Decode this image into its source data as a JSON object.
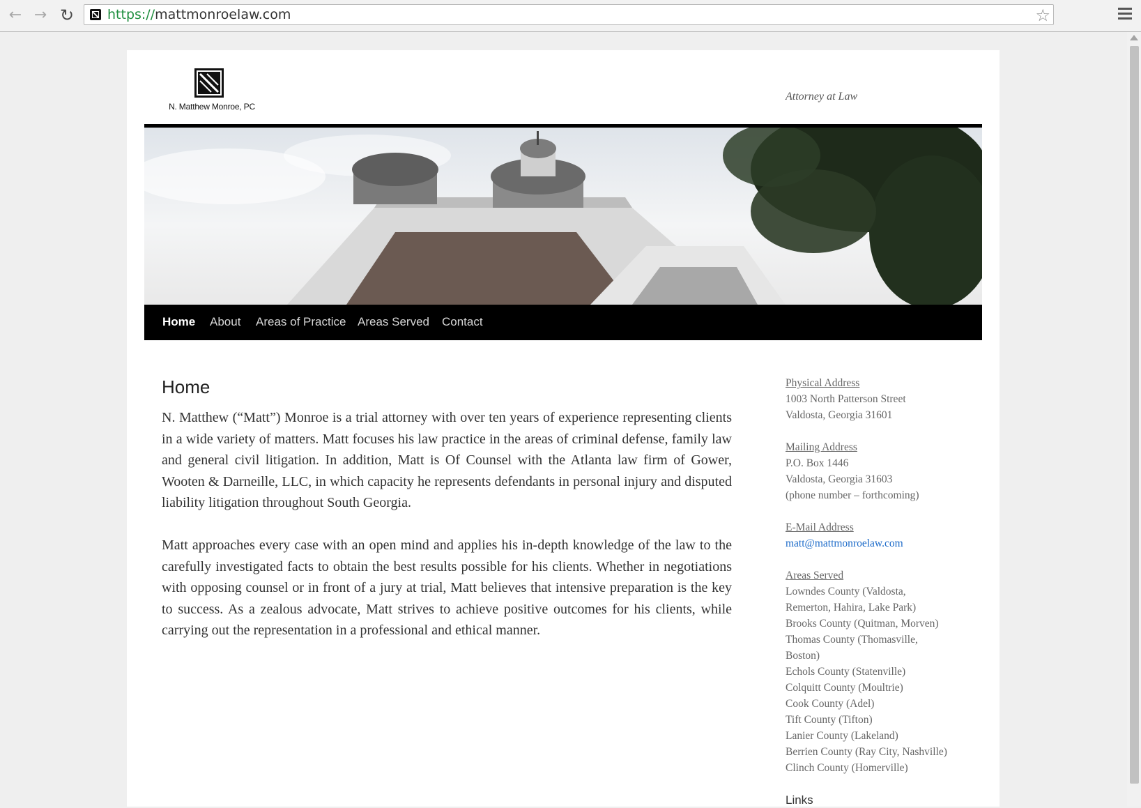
{
  "browser": {
    "url_scheme": "https://",
    "url_host": "mattmonroelaw.com",
    "back_icon": "back-arrow-icon",
    "forward_icon": "forward-arrow-icon",
    "reload_icon": "reload-icon",
    "star_icon": "bookmark-star-icon",
    "menu_icon": "hamburger-menu-icon"
  },
  "header": {
    "logo_name": "N. Matthew Monroe, PC",
    "tagline": "Attorney at Law"
  },
  "nav": {
    "items": [
      {
        "label": "Home"
      },
      {
        "label": "About"
      },
      {
        "label": "Areas of Practice"
      },
      {
        "label": "Areas Served"
      },
      {
        "label": "Contact"
      }
    ]
  },
  "main": {
    "title": "Home",
    "paragraphs": [
      "N. Matthew (“Matt”) Monroe is a trial attorney with over ten years of experience representing clients in a wide variety of matters. Matt focuses his law practice in the areas of criminal defense, family law and general civil litigation. In addition, Matt is Of Counsel with the Atlanta law firm of Gower, Wooten & Darneille, LLC, in which capacity he represents defendants in personal injury and disputed liability litigation throughout South Georgia.",
      "Matt approaches every case with an open mind and applies his in-depth knowledge of the law to the carefully investigated facts to obtain the best results possible for his clients. Whether in negotiations with opposing counsel or in front of a jury at trial, Matt believes that intensive preparation is the key to success. As a zealous advocate, Matt strives to achieve positive outcomes for his clients, while carrying out the representation in a professional and ethical manner."
    ]
  },
  "sidebar": {
    "physical": {
      "heading": "Physical Address",
      "line1": "1003 North Patterson Street",
      "line2": "Valdosta, Georgia 31601"
    },
    "mailing": {
      "heading": "Mailing Address",
      "line1": "P.O. Box 1446",
      "line2": "Valdosta, Georgia 31603",
      "line3": "(phone number – forthcoming)"
    },
    "email": {
      "heading": "E-Mail Address",
      "address": "matt@mattmonroelaw.com"
    },
    "areas": {
      "heading": "Areas Served",
      "lines": [
        "Lowndes County (Valdosta,",
        "Remerton, Hahira, Lake Park)",
        "Brooks County (Quitman, Morven)",
        "Thomas County (Thomasville,",
        "Boston)",
        "Echols County (Statenville)",
        "Colquitt County (Moultrie)",
        "Cook County (Adel)",
        "Tift County (Tifton)",
        "Lanier County (Lakeland)",
        "Berrien County (Ray City, Nashville)",
        "Clinch County (Homerville)"
      ]
    },
    "links_heading": "Links"
  }
}
